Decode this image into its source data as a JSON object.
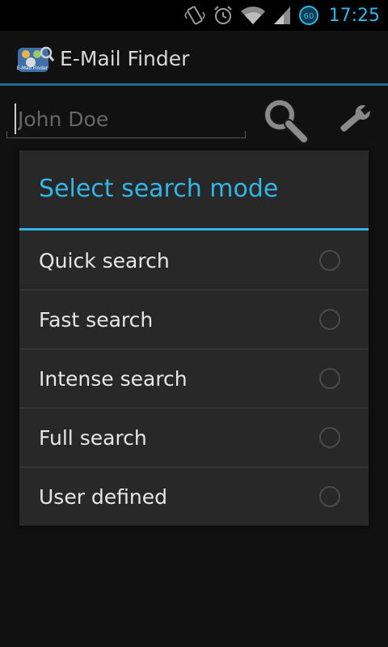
{
  "status_bar": {
    "time": "17:25",
    "battery_level": "60",
    "icons": [
      "vibrate-icon",
      "alarm-icon",
      "wifi-icon",
      "signal-icon",
      "battery-icon"
    ]
  },
  "action_bar": {
    "title": "E-Mail Finder",
    "logo_text": "E-Mail Finder"
  },
  "search": {
    "placeholder": "John Doe",
    "value": ""
  },
  "dialog": {
    "title": "Select search mode",
    "options": [
      {
        "label": "Quick search",
        "selected": false
      },
      {
        "label": "Fast search",
        "selected": false
      },
      {
        "label": "Intense search",
        "selected": false
      },
      {
        "label": "Full search",
        "selected": false
      },
      {
        "label": "User defined",
        "selected": false
      }
    ]
  },
  "colors": {
    "accent": "#33b5e5",
    "background": "#111111",
    "dialog_bg": "#282828"
  }
}
